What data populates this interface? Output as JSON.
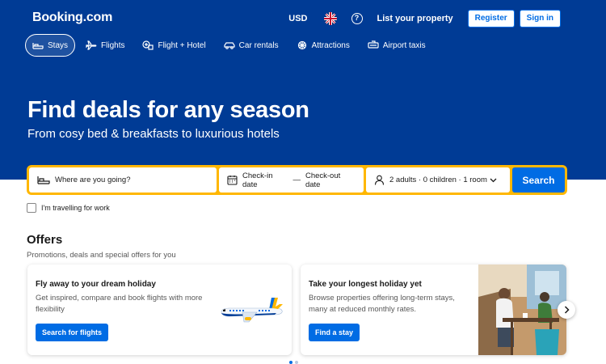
{
  "brand": {
    "logo": "Booking.com",
    "primary": "#003b95",
    "accent": "#006ce4",
    "highlight": "#ffb700"
  },
  "header": {
    "currency": "USD",
    "language_icon": "uk-flag-icon",
    "help_icon": "question-icon",
    "help_glyph": "?",
    "list_property": "List your property",
    "register": "Register",
    "sign_in": "Sign in"
  },
  "nav": {
    "items": [
      {
        "label": "Stays",
        "icon": "bed-icon",
        "active": true
      },
      {
        "label": "Flights",
        "icon": "plane-icon"
      },
      {
        "label": "Flight + Hotel",
        "icon": "plane-hotel-icon"
      },
      {
        "label": "Car rentals",
        "icon": "car-icon"
      },
      {
        "label": "Attractions",
        "icon": "ferris-wheel-icon"
      },
      {
        "label": "Airport taxis",
        "icon": "taxi-icon"
      }
    ]
  },
  "hero": {
    "title": "Find deals for any season",
    "subtitle": "From cosy bed & breakfasts to luxurious hotels"
  },
  "search": {
    "destination_placeholder": "Where are you going?",
    "checkin": "Check-in date",
    "date_separator": "—",
    "checkout": "Check-out date",
    "occupancy": "2 adults · 0 children · 1 room",
    "button": "Search"
  },
  "work_checkbox": {
    "label": "I'm travelling for work",
    "checked": false
  },
  "offers": {
    "title": "Offers",
    "subtitle": "Promotions, deals and special offers for you",
    "cards": [
      {
        "title": "Fly away to your dream holiday",
        "description": "Get inspired, compare and book flights with more flexibility",
        "button": "Search for flights",
        "image_icon": "airplane-illustration"
      },
      {
        "title": "Take your longest holiday yet",
        "description": "Browse properties offering long-term stays, many at reduced monthly rates.",
        "button": "Find a stay",
        "image_icon": "cafe-photo"
      }
    ]
  }
}
